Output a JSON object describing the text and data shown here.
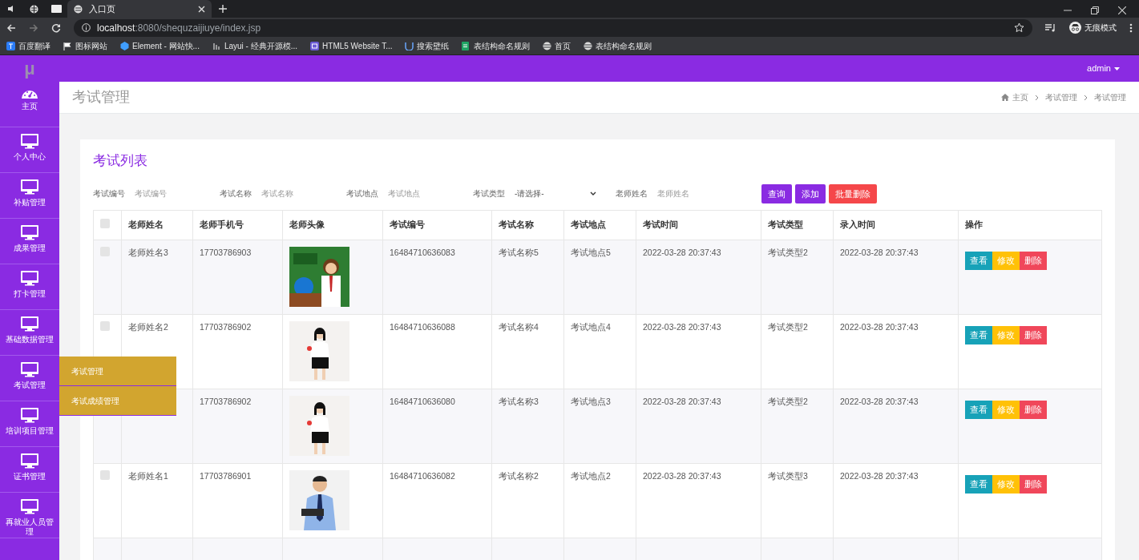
{
  "browser": {
    "tabs": [
      {
        "label": "入口页",
        "selected": true
      }
    ],
    "url_host": "localhost",
    "url_path": ":8080/shequzaijiuye/index.jsp",
    "profile": "无痕模式",
    "bookmarks": [
      {
        "label": "百度翻译",
        "kind": "translate"
      },
      {
        "label": "图标网站",
        "kind": "flag"
      },
      {
        "label": "Element - 网站快...",
        "kind": "hexagon"
      },
      {
        "label": "Layui - 经典开源模...",
        "kind": "bars"
      },
      {
        "label": "HTML5 Website T...",
        "kind": "window"
      },
      {
        "label": "搜索壁纸",
        "kind": "cup"
      },
      {
        "label": "表结构命名规则",
        "kind": "sheet"
      },
      {
        "label": "首页",
        "kind": "globe"
      },
      {
        "label": "表结构命名规则",
        "kind": "globe"
      }
    ]
  },
  "app": {
    "logo": "μ",
    "user": "admin",
    "sidebar": [
      {
        "label": "主页",
        "kind": "gauge"
      },
      {
        "label": "个人中心",
        "kind": "monitor"
      },
      {
        "label": "补贴管理",
        "kind": "monitor"
      },
      {
        "label": "成果管理",
        "kind": "monitor"
      },
      {
        "label": "打卡管理",
        "kind": "monitor"
      },
      {
        "label": "基础数据管理",
        "kind": "monitor"
      },
      {
        "label": "考试管理",
        "kind": "monitor"
      },
      {
        "label": "培训项目管理",
        "kind": "monitor"
      },
      {
        "label": "证书管理",
        "kind": "monitor"
      },
      {
        "label": "再就业人员管理",
        "kind": "monitor"
      }
    ],
    "submenu": [
      {
        "label": "考试管理"
      },
      {
        "label": "考试成绩管理"
      }
    ],
    "page_title": "考试管理",
    "breadcrumb": [
      "主页",
      "考试管理",
      "考试管理"
    ],
    "card_title": "考试列表",
    "filters": [
      {
        "label": "考试编号",
        "kind": "input",
        "placeholder": "考试编号"
      },
      {
        "label": "考试名称",
        "kind": "input",
        "placeholder": "考试名称"
      },
      {
        "label": "考试地点",
        "kind": "input",
        "placeholder": "考试地点"
      },
      {
        "label": "考试类型",
        "kind": "select",
        "value": "-请选择-"
      },
      {
        "label": "老师姓名",
        "kind": "input",
        "placeholder": "老师姓名"
      }
    ],
    "buttons": [
      {
        "label": "查询",
        "kind": "primary"
      },
      {
        "label": "添加",
        "kind": "primary"
      },
      {
        "label": "批量删除",
        "kind": "danger"
      }
    ],
    "table": {
      "select_all_checked": false,
      "columns": [
        "老师姓名",
        "老师手机号",
        "老师头像",
        "考试编号",
        "考试名称",
        "考试地点",
        "考试时间",
        "考试类型",
        "录入时间",
        "操作"
      ],
      "rows": [
        {
          "checked": false,
          "name": "老师姓名3",
          "phone": "17703786903",
          "avatar": {
            "kind": "picture"
          },
          "exam_no": "16484710636083",
          "exam_name": "考试名称5",
          "place": "考试地点5",
          "time": "2022-03-28 20:37:43",
          "type": "考试类型2",
          "entry_time": "2022-03-28 20:37:43",
          "actions": [
            {
              "label": "查看",
              "kind": "view"
            },
            {
              "label": "修改",
              "kind": "edit"
            },
            {
              "label": "删除",
              "kind": "delete"
            }
          ]
        },
        {
          "checked": false,
          "name": "老师姓名2",
          "phone": "17703786902",
          "avatar": {
            "kind": "picture"
          },
          "exam_no": "16484710636088",
          "exam_name": "考试名称4",
          "place": "考试地点4",
          "time": "2022-03-28 20:37:43",
          "type": "考试类型2",
          "entry_time": "2022-03-28 20:37:43",
          "actions": [
            {
              "label": "查看",
              "kind": "view"
            },
            {
              "label": "修改",
              "kind": "edit"
            },
            {
              "label": "删除",
              "kind": "delete"
            }
          ]
        },
        {
          "phone": "17703786902",
          "avatar": {
            "kind": "picture"
          },
          "exam_no": "16484710636080",
          "exam_name": "考试名称3",
          "place": "考试地点3",
          "time": "2022-03-28 20:37:43",
          "type": "考试类型2",
          "entry_time": "2022-03-28 20:37:43",
          "actions": [
            {
              "label": "查看",
              "kind": "view"
            },
            {
              "label": "修改",
              "kind": "edit"
            },
            {
              "label": "删除",
              "kind": "delete"
            }
          ]
        },
        {
          "checked": false,
          "name": "老师姓名1",
          "phone": "17703786901",
          "avatar": {
            "kind": "picture"
          },
          "exam_no": "16484710636082",
          "exam_name": "考试名称2",
          "place": "考试地点2",
          "time": "2022-03-28 20:37:43",
          "type": "考试类型3",
          "entry_time": "2022-03-28 20:37:43",
          "actions": [
            {
              "label": "查看",
              "kind": "view"
            },
            {
              "label": "修改",
              "kind": "edit"
            },
            {
              "label": "删除",
              "kind": "delete"
            }
          ]
        }
      ]
    }
  }
}
